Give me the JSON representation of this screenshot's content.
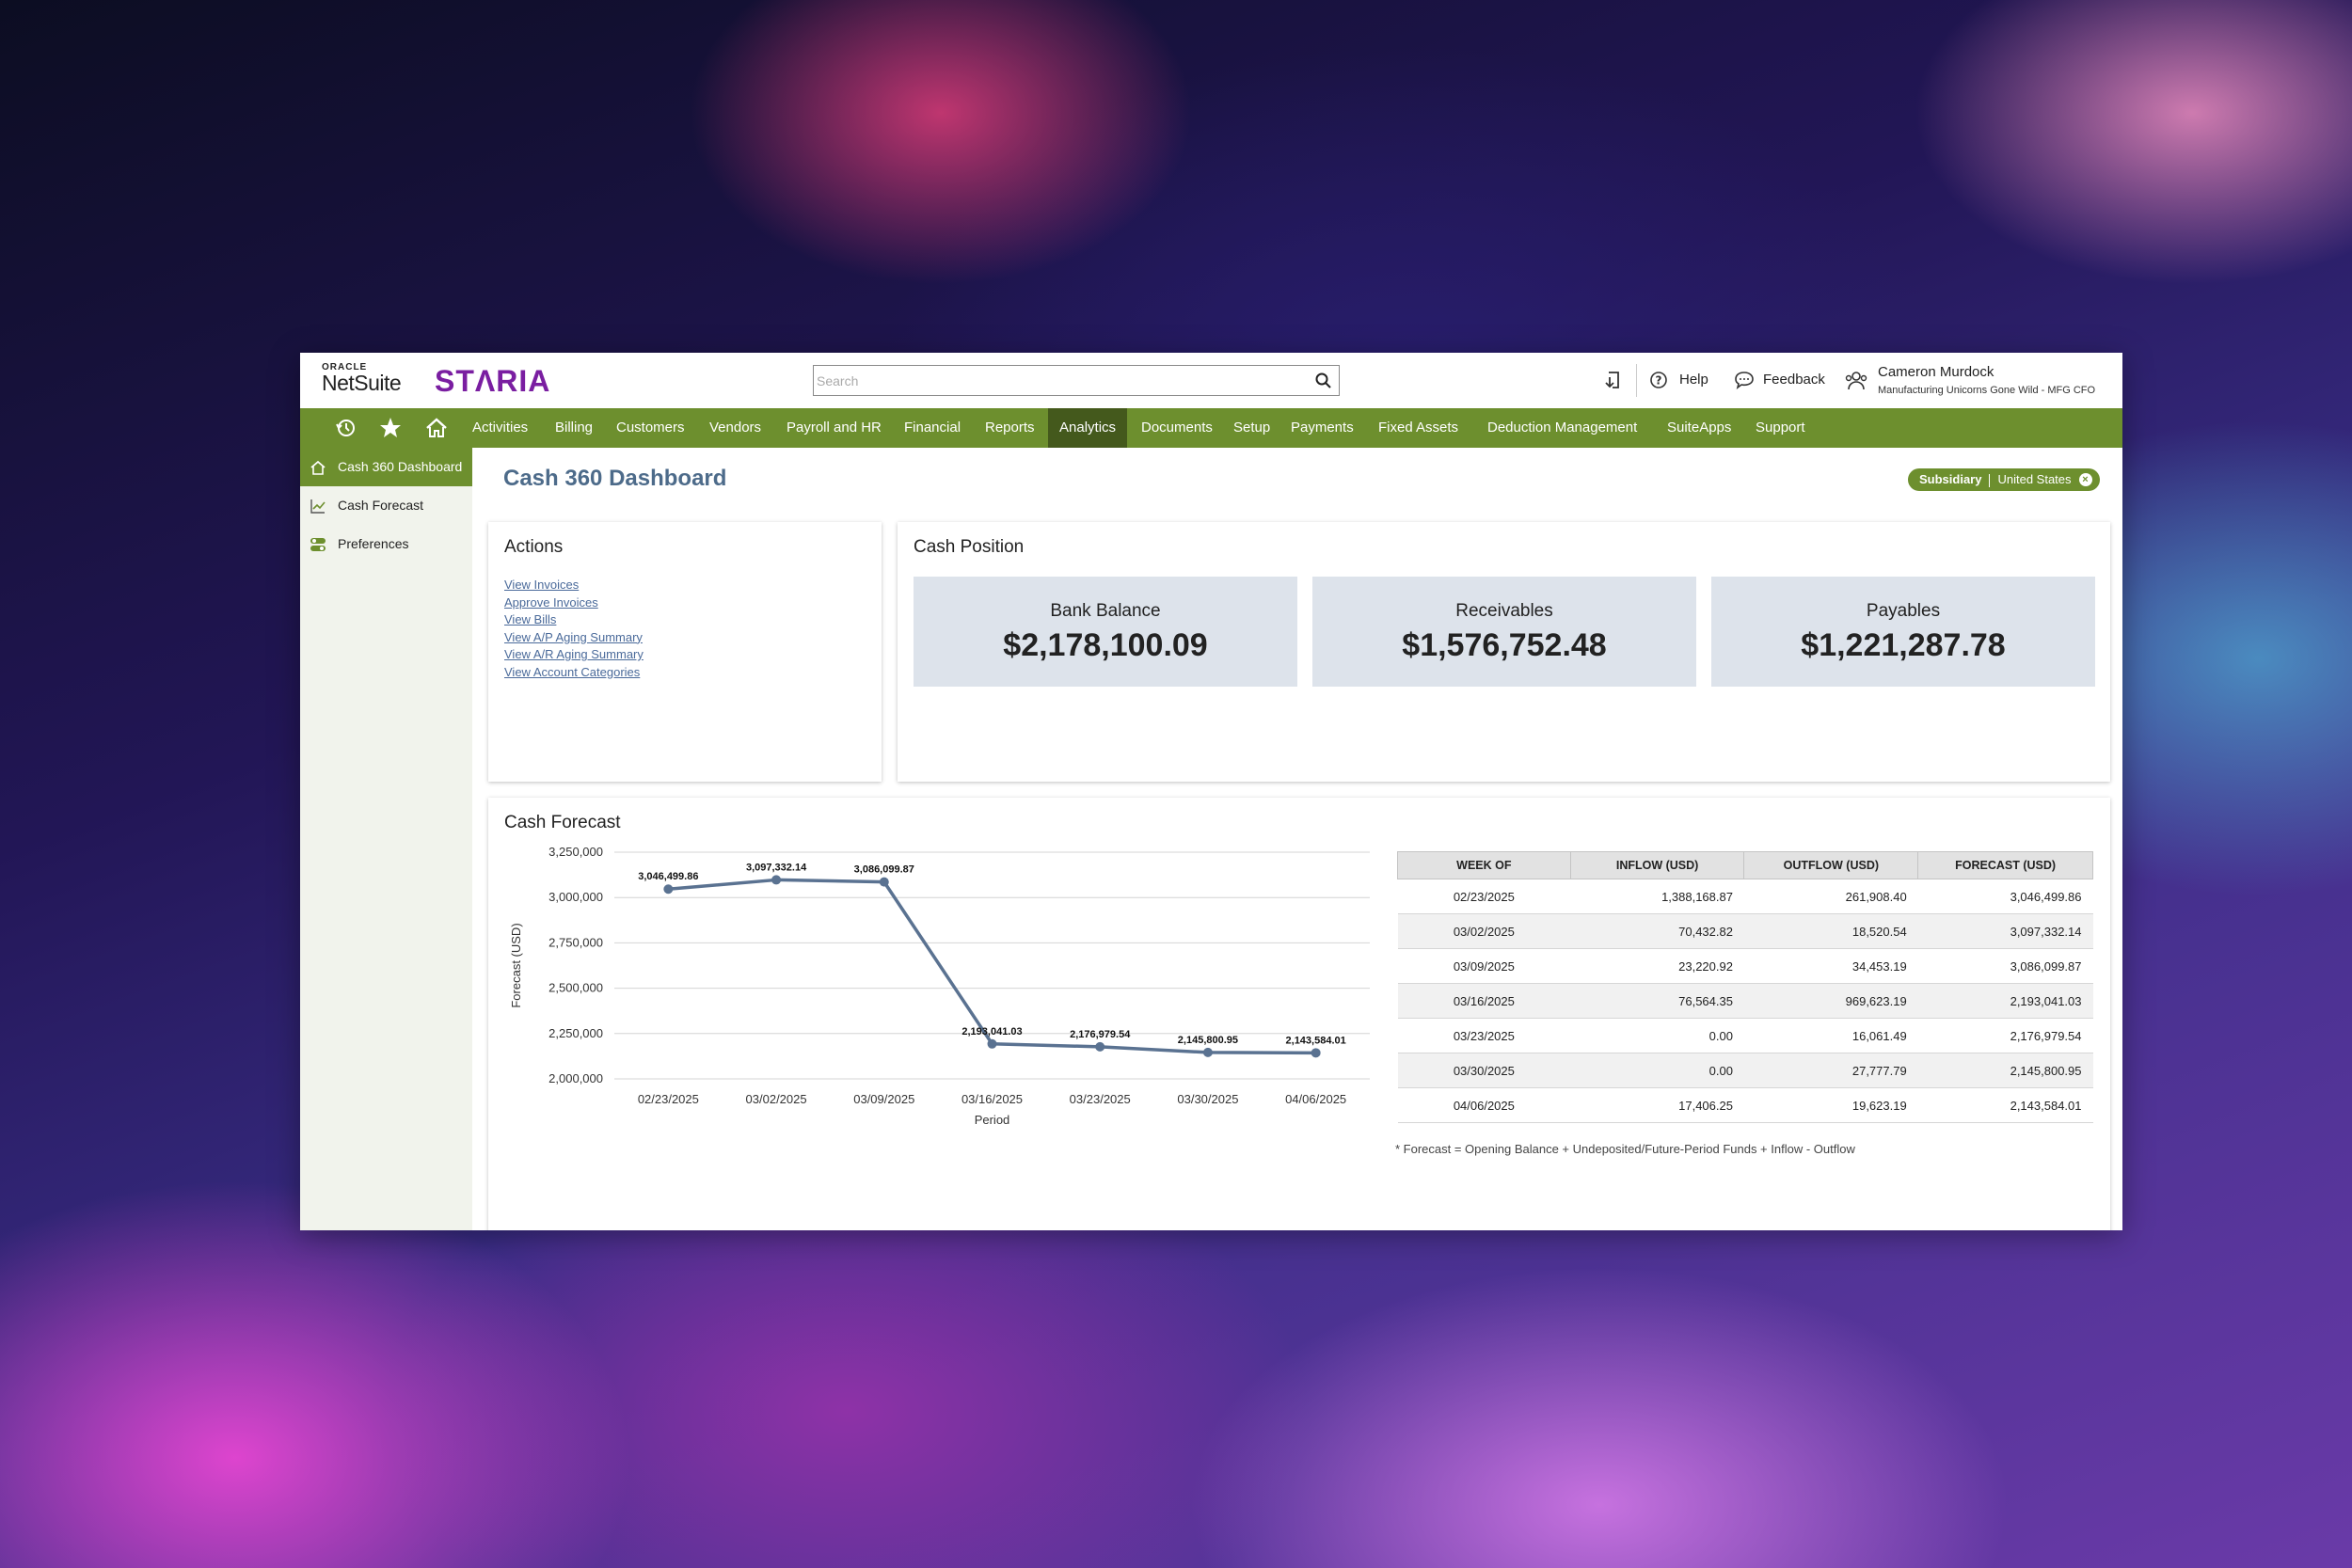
{
  "header": {
    "oracle_label": "ORACLE",
    "netsuite_label": "NetSuite",
    "brand": "STΛRIA",
    "search_placeholder": "Search",
    "help": "Help",
    "feedback": "Feedback",
    "user_name": "Cameron Murdock",
    "user_role": "Manufacturing Unicorns Gone Wild - MFG CFO"
  },
  "nav": {
    "items": [
      "Activities",
      "Billing",
      "Customers",
      "Vendors",
      "Payroll and HR",
      "Financial",
      "Reports",
      "Analytics",
      "Documents",
      "Setup",
      "Payments",
      "Fixed Assets",
      "Deduction Management",
      "SuiteApps",
      "Support"
    ],
    "active": "Analytics",
    "accent_color": "#6d8f2e"
  },
  "sidebar": {
    "items": [
      {
        "label": "Cash 360 Dashboard",
        "icon": "home-icon",
        "active": true
      },
      {
        "label": "Cash Forecast",
        "icon": "line-chart-icon",
        "active": false
      },
      {
        "label": "Preferences",
        "icon": "toggle-settings-icon",
        "active": false
      }
    ],
    "collapse_label": "«"
  },
  "page": {
    "title": "Cash 360 Dashboard",
    "subsidiary_label": "Subsidiary",
    "subsidiary_value": "United States"
  },
  "actions": {
    "title": "Actions",
    "links": [
      "View Invoices",
      "Approve Invoices",
      "View Bills",
      "View A/P Aging Summary",
      "View A/R Aging Summary",
      "View Account Categories"
    ]
  },
  "cash_position": {
    "title": "Cash Position",
    "kpis": [
      {
        "label": "Bank Balance",
        "value": "$2,178,100.09"
      },
      {
        "label": "Receivables",
        "value": "$1,576,752.48"
      },
      {
        "label": "Payables",
        "value": "$1,221,287.78"
      }
    ],
    "tile_color": "#dde3eb"
  },
  "cash_forecast": {
    "title": "Cash Forecast",
    "table": {
      "headers": [
        "WEEK OF",
        "INFLOW (USD)",
        "OUTFLOW (USD)",
        "FORECAST (USD)"
      ],
      "rows": [
        [
          "02/23/2025",
          "1,388,168.87",
          "261,908.40",
          "3,046,499.86"
        ],
        [
          "03/02/2025",
          "70,432.82",
          "18,520.54",
          "3,097,332.14"
        ],
        [
          "03/09/2025",
          "23,220.92",
          "34,453.19",
          "3,086,099.87"
        ],
        [
          "03/16/2025",
          "76,564.35",
          "969,623.19",
          "2,193,041.03"
        ],
        [
          "03/23/2025",
          "0.00",
          "16,061.49",
          "2,176,979.54"
        ],
        [
          "03/30/2025",
          "0.00",
          "27,777.79",
          "2,145,800.95"
        ],
        [
          "04/06/2025",
          "17,406.25",
          "19,623.19",
          "2,143,584.01"
        ]
      ]
    },
    "footnote": "* Forecast = Opening Balance + Undeposited/Future-Period Funds + Inflow - Outflow"
  },
  "chart_data": {
    "type": "line",
    "categories": [
      "02/23/2025",
      "03/02/2025",
      "03/09/2025",
      "03/16/2025",
      "03/23/2025",
      "03/30/2025",
      "04/06/2025"
    ],
    "values": [
      3046499.86,
      3097332.14,
      3086099.87,
      2193041.03,
      2176979.54,
      2145800.95,
      2143584.01
    ],
    "value_labels": [
      "3,046,499.86",
      "3,097,332.14",
      "3,086,099.87",
      "2,193,041.03",
      "2,176,979.54",
      "2,145,800.95",
      "2,143,584.01"
    ],
    "xlabel": "Period",
    "ylabel": "Forecast (USD)",
    "ylim": [
      2000000,
      3250000
    ],
    "yticks": [
      2000000,
      2250000,
      2500000,
      2750000,
      3000000,
      3250000
    ],
    "ytick_labels": [
      "2,000,000",
      "2,250,000",
      "2,500,000",
      "2,750,000",
      "3,000,000",
      "3,250,000"
    ],
    "grid": true,
    "line_color": "#5a7291"
  }
}
